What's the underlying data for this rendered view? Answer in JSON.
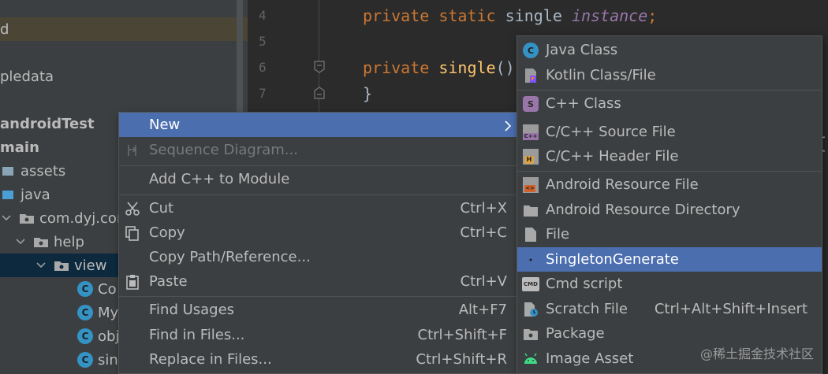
{
  "project_tree": {
    "rows": [
      {
        "label": "d"
      },
      {
        "label": "pledata"
      },
      {
        "label": "androidTest"
      },
      {
        "label": "main"
      },
      {
        "label": "assets"
      },
      {
        "label": "java"
      },
      {
        "label": "com.dyj.cons"
      },
      {
        "label": "help"
      },
      {
        "label": "view"
      },
      {
        "label": "Co"
      },
      {
        "label": "My"
      },
      {
        "label": "obj"
      },
      {
        "label": "sin"
      }
    ]
  },
  "editor": {
    "line_numbers": [
      "4",
      "5",
      "6",
      "7"
    ],
    "line4": {
      "kw1": "private",
      "kw2": "static",
      "type": "single",
      "var": "instance",
      "semi": ";"
    },
    "line6": {
      "kw": "private",
      "fn": "single",
      "parens": "()"
    },
    "line7": {
      "brace": "}"
    },
    "right_brace": "{"
  },
  "context_menu": {
    "items": [
      {
        "label": "New",
        "arrow": "›"
      },
      {
        "label": "Sequence Diagram..."
      },
      {
        "label": "Add C++ to Module"
      },
      {
        "label": "Cut",
        "shortcut": "Ctrl+X"
      },
      {
        "label": "Copy",
        "shortcut": "Ctrl+C"
      },
      {
        "label": "Copy Path/Reference..."
      },
      {
        "label": "Paste",
        "shortcut": "Ctrl+V"
      },
      {
        "label": "Find Usages",
        "shortcut": "Alt+F7"
      },
      {
        "label": "Find in Files...",
        "shortcut": "Ctrl+Shift+F"
      },
      {
        "label": "Replace in Files...",
        "shortcut": "Ctrl+Shift+R"
      }
    ]
  },
  "submenu": {
    "items": [
      {
        "label": "Java Class",
        "icon_letter": "C"
      },
      {
        "label": "Kotlin Class/File"
      },
      {
        "label": "C++ Class",
        "icon_letter": "S"
      },
      {
        "label": "C/C++ Source File",
        "icon_letter": "C++"
      },
      {
        "label": "C/C++ Header File",
        "icon_letter": "H"
      },
      {
        "label": "Android Resource File",
        "icon_letter": "<>"
      },
      {
        "label": "Android Resource Directory"
      },
      {
        "label": "File"
      },
      {
        "label": "SingletonGenerate"
      },
      {
        "label": "Cmd script",
        "icon_letter": "CMD"
      },
      {
        "label": "Scratch File",
        "shortcut": "Ctrl+Alt+Shift+Insert"
      },
      {
        "label": "Package"
      },
      {
        "label": "Image Asset"
      }
    ]
  },
  "watermark": "@稀土掘金技术社区",
  "colors": {
    "selection": "#4b6eaf",
    "menu_bg": "#3c3f41",
    "editor_bg": "#2b2b2b",
    "keyword": "#cc7832",
    "function": "#ffc66d",
    "class_badge": "#3592c4"
  }
}
